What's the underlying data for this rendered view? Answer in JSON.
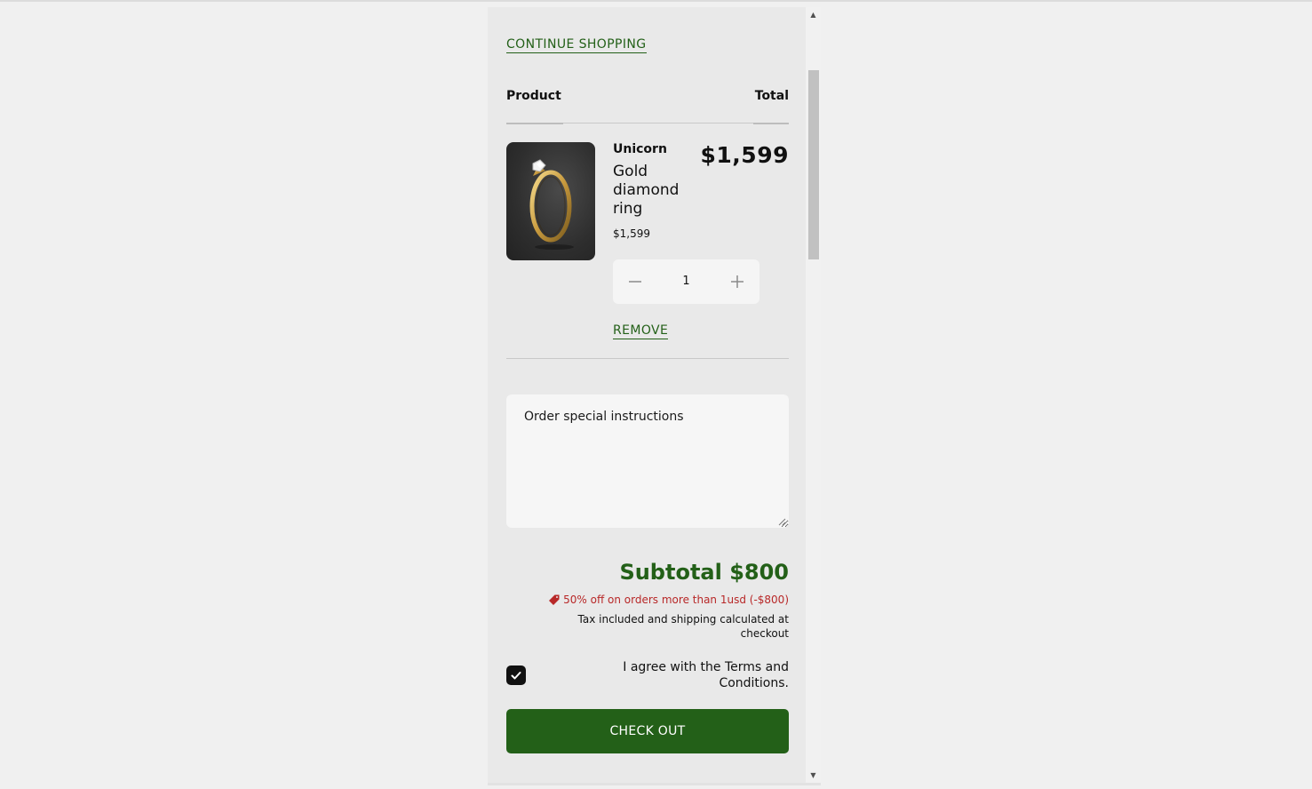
{
  "cart": {
    "continue_label": "CONTINUE SHOPPING",
    "headers": {
      "product": "Product",
      "total": "Total"
    },
    "item": {
      "vendor": "Unicorn",
      "name": "Gold diamond ring",
      "price": "$1,599",
      "line_total": "$1,599",
      "quantity": "1",
      "image": "gold-ring-image",
      "remove_label": "REMOVE"
    },
    "notes": {
      "placeholder": "Order special instructions"
    },
    "subtotal": "Subtotal $800",
    "discount": "50% off on orders more than 1usd (-$800)",
    "tax_note": "Tax included and shipping calculated at checkout",
    "terms_label": "I agree with the Terms and Conditions.",
    "terms_checked": true,
    "checkout_label": "CHECK OUT"
  },
  "colors": {
    "accent": "#236018",
    "discount": "#b82828",
    "drawer_bg": "#e9e9e9"
  }
}
